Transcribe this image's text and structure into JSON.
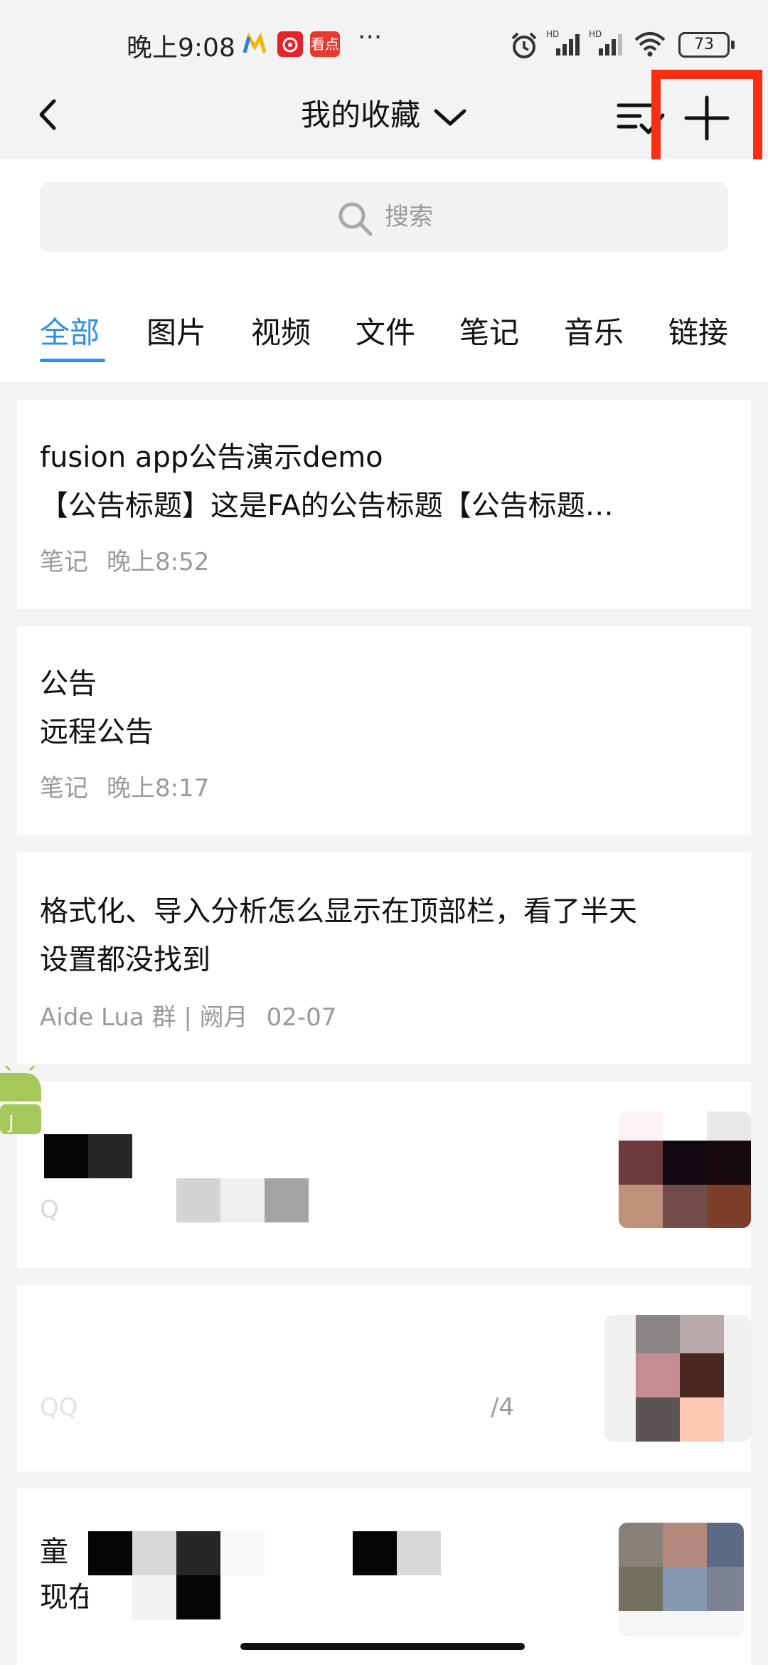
{
  "status_bar": {
    "time": "晚上9:08",
    "app_icons": [
      {
        "name": "m-app-icon",
        "color": "#f7b500"
      },
      {
        "name": "netease-music-icon",
        "color": "#e6232b"
      },
      {
        "name": "kandian-icon",
        "label": "看点",
        "color": "#e8392d"
      }
    ],
    "more": "···",
    "battery": "73"
  },
  "title_bar": {
    "title": "我的收藏"
  },
  "search": {
    "placeholder": "搜索"
  },
  "tabs": [
    {
      "label": "全部",
      "active": true
    },
    {
      "label": "图片"
    },
    {
      "label": "视频"
    },
    {
      "label": "文件"
    },
    {
      "label": "笔记"
    },
    {
      "label": "音乐"
    },
    {
      "label": "链接"
    }
  ],
  "items": [
    {
      "title": "fusion app公告演示demo",
      "subtitle": "【公告标题】这是FA的公告标题【公告标题…",
      "type": "笔记",
      "time": "晚上8:52"
    },
    {
      "title": "公告",
      "subtitle": "远程公告",
      "type": "笔记",
      "time": "晚上8:17"
    },
    {
      "title": "格式化、导入分析怎么显示在顶部栏，看了半天",
      "subtitle": "设置都没找到",
      "source": "Aide Lua 群 | 阙月",
      "time": "02-07"
    },
    {
      "meta_fragment": "Q"
    },
    {
      "meta_fragment": "QQ",
      "meta_fragment_right": "/4"
    },
    {
      "title_fragment": "童",
      "subtitle_fragment": "现在"
    }
  ],
  "colors": {
    "accent": "#2f8fe6",
    "highlight_box": "#fb2d13"
  }
}
